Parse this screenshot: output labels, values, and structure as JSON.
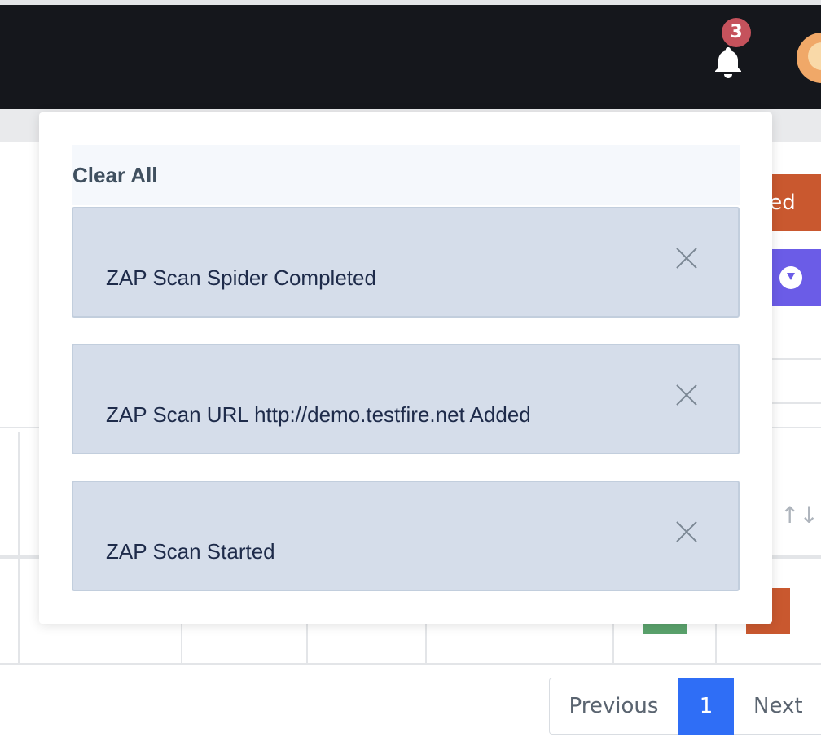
{
  "header": {
    "notification_count": "3",
    "icons": [
      "bell-icon",
      "avatar"
    ]
  },
  "background": {
    "orange_button_partial": "ted",
    "sort_icon": "↑↓"
  },
  "notifications": {
    "clear_all_label": "Clear All",
    "items": [
      {
        "message": "ZAP Scan Spider Completed"
      },
      {
        "message": "ZAP Scan URL http://demo.testfire.net Added"
      },
      {
        "message": "ZAP Scan Started"
      }
    ]
  },
  "pagination": {
    "previous_label": "Previous",
    "current_page": "1",
    "next_label": "Next"
  },
  "colors": {
    "navbar": "#15171c",
    "badge": "#c5525c",
    "notification_bg": "#d5ddea",
    "active_page": "#2f6ef6"
  }
}
